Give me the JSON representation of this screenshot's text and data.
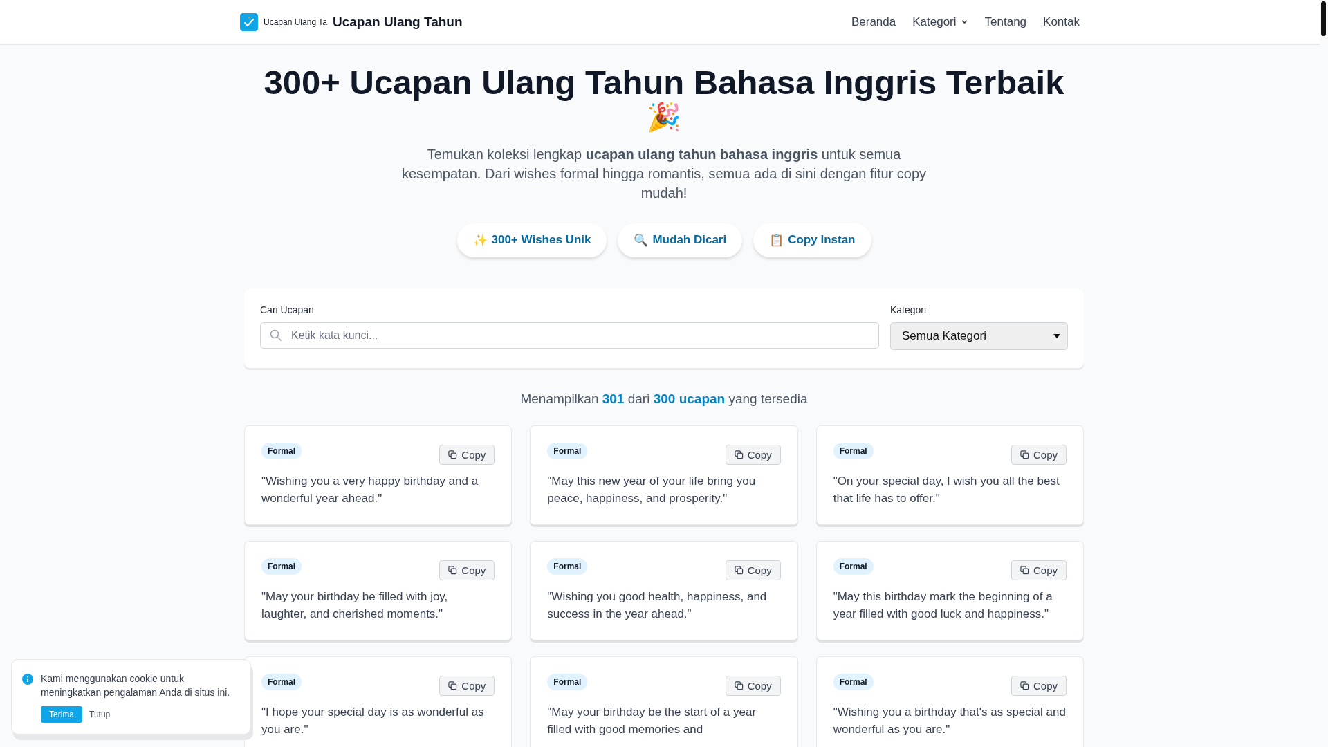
{
  "header": {
    "logo_text": "Ucapan Ulang Ta",
    "title": "Ucapan Ulang Tahun",
    "nav": [
      {
        "label": "Beranda",
        "kind": "link"
      },
      {
        "label": "Kategori",
        "kind": "dropdown"
      },
      {
        "label": "Tentang",
        "kind": "link"
      },
      {
        "label": "Kontak",
        "kind": "link"
      }
    ]
  },
  "hero": {
    "title": "300+ Ucapan Ulang Tahun Bahasa Inggris Terbaik",
    "emoji": "🎉",
    "subtitle": "Temukan koleksi lengkap **ucapan ulang tahun bahasa inggris** untuk semua kesempatan. Dari wishes formal hingga romantis, semua ada di sini dengan fitur copy mudah!",
    "features": [
      {
        "icon": "✨",
        "label": "300+ Wishes Unik"
      },
      {
        "icon": "🔍",
        "label": "Mudah Dicari"
      },
      {
        "icon": "📋",
        "label": "Copy Instan"
      }
    ]
  },
  "search": {
    "label": "Cari Ucapan",
    "placeholder": "Ketik kata kunci...",
    "category_label": "Kategori",
    "category_value": "Semua Kategori"
  },
  "results": "Menampilkan **301** dari **300 ucapan** yang tersedia",
  "cards": [
    {
      "category": "Formal",
      "copy_label": "Copy",
      "text": "\"Wishing you a very happy birthday and a wonderful year ahead.\""
    },
    {
      "category": "Formal",
      "copy_label": "Copy",
      "text": "\"May this new year of your life bring you peace, happiness, and prosperity.\""
    },
    {
      "category": "Formal",
      "copy_label": "Copy",
      "text": "\"On your special day, I wish you all the best that life has to offer.\""
    },
    {
      "category": "Formal",
      "copy_label": "Copy",
      "text": "\"May your birthday be filled with joy, laughter, and cherished moments.\""
    },
    {
      "category": "Formal",
      "copy_label": "Copy",
      "text": "\"Wishing you good health, happiness, and success in the year ahead.\""
    },
    {
      "category": "Formal",
      "copy_label": "Copy",
      "text": "\"May this birthday mark the beginning of a year filled with good luck and happiness.\""
    },
    {
      "category": "Formal",
      "copy_label": "Copy",
      "text": "\"I hope your special day is as wonderful as you are.\""
    },
    {
      "category": "Formal",
      "copy_label": "Copy",
      "text": "\"May your birthday be the start of a year filled with good memories and"
    },
    {
      "category": "Formal",
      "copy_label": "Copy",
      "text": "\"Wishing you a birthday that's as special and wonderful as you are.\""
    }
  ],
  "cookie": {
    "message": "Kami menggunakan cookie untuk meningkatkan pengalaman Anda di situs ini.",
    "accept": "Terima",
    "close": "Tutup"
  }
}
